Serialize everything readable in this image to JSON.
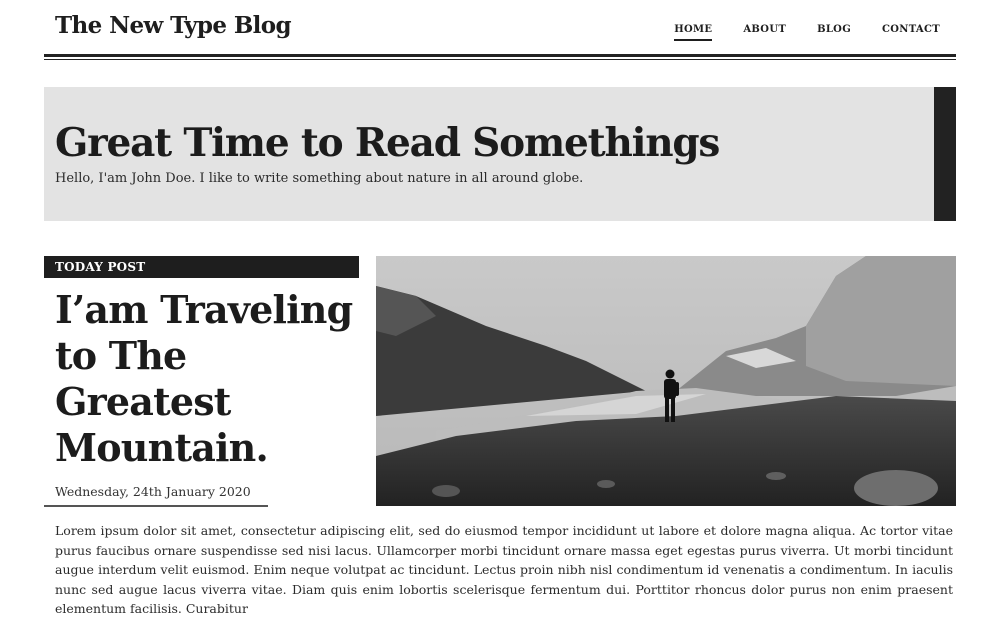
{
  "header": {
    "brand": "The New Type Blog",
    "nav": [
      {
        "label": "HOME",
        "active": true
      },
      {
        "label": "ABOUT",
        "active": false
      },
      {
        "label": "BLOG",
        "active": false
      },
      {
        "label": "CONTACT",
        "active": false
      }
    ]
  },
  "hero": {
    "title": "Great Time to Read Somethings",
    "subtitle": "Hello, I'am John Doe. I like to write something about nature in all around globe."
  },
  "post": {
    "badge": "TODAY POST",
    "title": "I’am Traveling to The Greatest Mountain.",
    "date": "Wednesday, 24th January 2020",
    "image_icon": "mountain-photo",
    "body": "Lorem ipsum dolor sit amet, consectetur adipiscing elit, sed do eiusmod tempor incididunt ut labore et dolore magna aliqua. Ac tortor vitae purus faucibus ornare suspendisse sed nisi lacus. Ullamcorper morbi tincidunt ornare massa eget egestas purus viverra. Ut morbi tincidunt augue interdum velit euismod. Enim neque volutpat ac tincidunt. Lectus proin nibh nisl condimentum id venenatis a condimentum. In iaculis nunc sed augue lacus viverra vitae. Diam quis enim lobortis scelerisque fermentum dui. Porttitor rhoncus dolor purus non enim praesent elementum facilisis. Curabitur"
  },
  "colors": {
    "ink": "#1e1e1e",
    "hero_bg": "#e3e3e3",
    "accent_bar": "#222222"
  }
}
